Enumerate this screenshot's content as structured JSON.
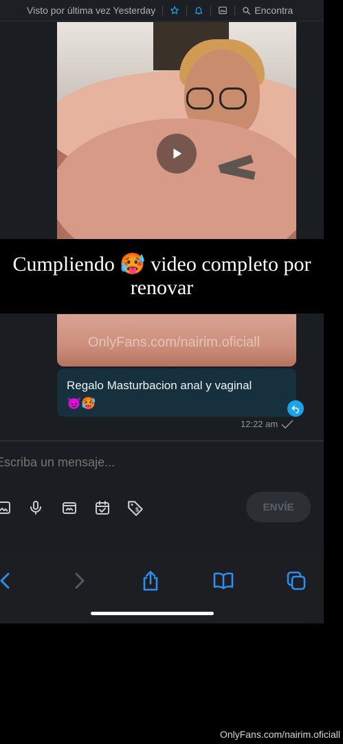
{
  "header": {
    "status": "Visto por última vez Yesterday",
    "search_label": "Encontra"
  },
  "caption": {
    "line1": "Cumpliendo 🥵 video completo por",
    "line2": "renovar"
  },
  "media_watermark": "OnlyFans.com/nairim.oficiall",
  "message": {
    "text": "Regalo Masturbacion anal y vaginal",
    "emojis": "😈🥵",
    "time": "12:22 am"
  },
  "composer": {
    "placeholder": "Escriba un mensaje...",
    "send_label": "ENVÍE"
  },
  "footer_watermark": "OnlyFans.com/nairim.oficiall",
  "colors": {
    "accent": "#1aa3e8",
    "safari_blue": "#2f8cf0",
    "bubble": "#16303d"
  }
}
